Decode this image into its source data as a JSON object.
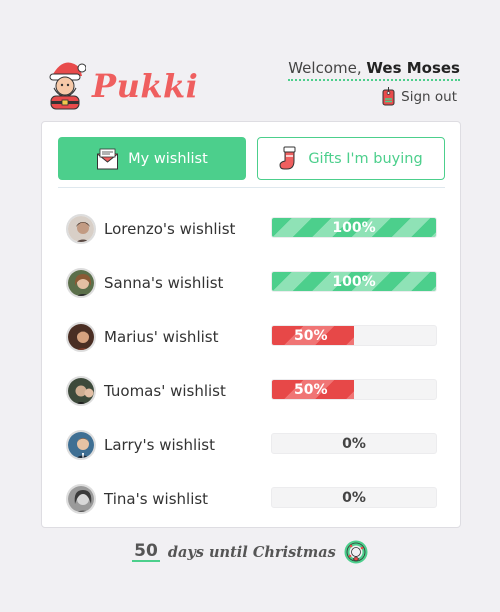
{
  "app": {
    "name": "Pukki",
    "welcome_prefix": "Welcome,",
    "user_name": "Wes Moses",
    "signout_label": "Sign out",
    "colors": {
      "accent": "#4ccf8c",
      "brand": "#ef5f5f",
      "danger": "#e74848"
    }
  },
  "tabs": [
    {
      "label": "My wishlist",
      "icon": "envelope-icon",
      "active": true
    },
    {
      "label": "Gifts I'm buying",
      "icon": "stocking-icon",
      "active": false
    }
  ],
  "wishlists": [
    {
      "label": "Lorenzo's wishlist",
      "progress_percent": 100,
      "progress_text": "100%"
    },
    {
      "label": "Sanna's wishlist",
      "progress_percent": 100,
      "progress_text": "100%"
    },
    {
      "label": "Marius' wishlist",
      "progress_percent": 50,
      "progress_text": "50%"
    },
    {
      "label": "Tuomas' wishlist",
      "progress_percent": 50,
      "progress_text": "50%"
    },
    {
      "label": "Larry's wishlist",
      "progress_percent": 0,
      "progress_text": "0%"
    },
    {
      "label": "Tina's wishlist",
      "progress_percent": 0,
      "progress_text": "0%"
    }
  ],
  "countdown": {
    "days": "50",
    "text": "days until Christmas",
    "icon": "wreath-icon"
  }
}
